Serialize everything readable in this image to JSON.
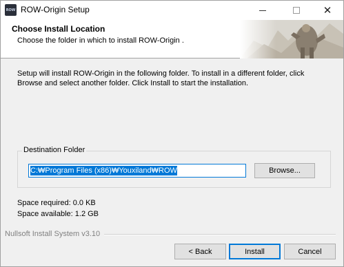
{
  "window": {
    "title": "ROW-Origin  Setup",
    "icon_text": "ROW",
    "icon_name": "row-origin-app-icon",
    "caption_buttons": {
      "minimize_icon": "minimize-icon",
      "maximize_icon": "maximize-icon",
      "close_icon": "close-icon",
      "close_glyph": "✕"
    }
  },
  "header": {
    "title": "Choose Install Location",
    "subtitle": "Choose the folder in which to install ROW-Origin ."
  },
  "body": {
    "description": "Setup will install ROW-Origin  in the following folder. To install in a different folder, click Browse and select another folder. Click Install to start the installation."
  },
  "destination": {
    "legend": "Destination Folder",
    "path": "C:₩Program Files (x86)₩Youxiland₩ROW",
    "browse_label": "Browse..."
  },
  "space": {
    "required": "Space required: 0.0 KB",
    "available": "Space available: 1.2 GB"
  },
  "footer": {
    "branding": "Nullsoft Install System v3.10",
    "back_label": "< Back",
    "install_label": "Install",
    "cancel_label": "Cancel"
  },
  "colors": {
    "accent": "#0078d7",
    "window_bg": "#f0f0f0",
    "header_bg": "#ffffff"
  }
}
